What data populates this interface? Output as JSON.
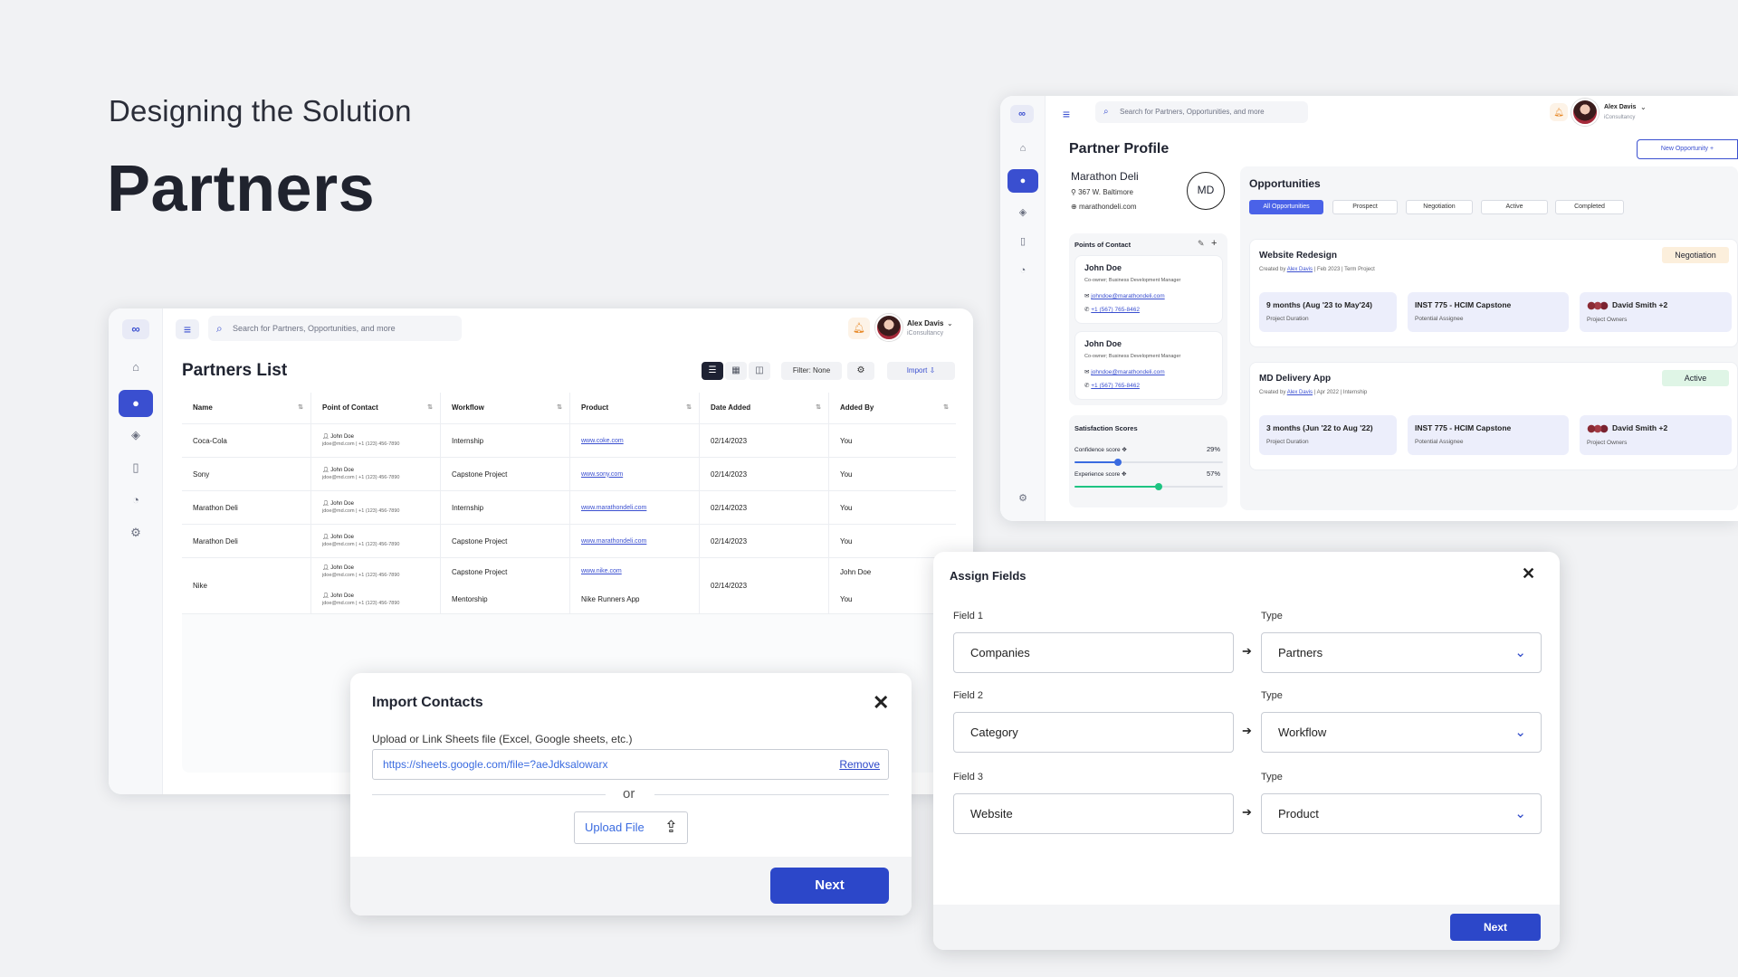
{
  "header": {
    "subtitle": "Designing the Solution",
    "title": "Partners"
  },
  "app": {
    "logo": "∞",
    "search_placeholder": "Search for Partners, Opportunities, and more",
    "user_name": "Alex Davis",
    "user_org": "iConsultancy"
  },
  "partners_list": {
    "title": "Partners List",
    "filter_label": "Filter: None",
    "import_label": "Import",
    "columns": [
      "Name",
      "Point of Contact",
      "Workflow",
      "Product",
      "Date Added",
      "Added By"
    ],
    "rows": [
      {
        "name": "Coca-Cola",
        "contact": "John Doe",
        "contact_detail": "jdoe@md.com | +1 (123) 456-7890",
        "workflow": "Internship",
        "product": "www.coke.com",
        "date": "02/14/2023",
        "added_by": "You"
      },
      {
        "name": "Sony",
        "contact": "John Doe",
        "contact_detail": "jdoe@md.com | +1 (123) 456-7890",
        "workflow": "Capstone Project",
        "product": "www.sony.com",
        "date": "02/14/2023",
        "added_by": "You"
      },
      {
        "name": "Marathon Deli",
        "contact": "John Doe",
        "contact_detail": "jdoe@md.com | +1 (123) 456-7890",
        "workflow": "Internship",
        "product": "www.marathondeli.com",
        "date": "02/14/2023",
        "added_by": "You"
      },
      {
        "name": "Marathon Deli",
        "contact": "John Doe",
        "contact_detail": "jdoe@md.com | +1 (123) 456-7890",
        "workflow": "Capstone Project",
        "product": "www.marathondeli.com",
        "date": "02/14/2023",
        "added_by": "You"
      }
    ],
    "nike": {
      "name": "Nike",
      "contact": "John Doe",
      "contact_detail": "jdoe@md.com | +1 (123) 456-7890",
      "workflow_1": "Capstone Project",
      "workflow_2": "Mentorship",
      "product_1": "www.nike.com",
      "product_2": "Nike Runners App",
      "date": "02/14/2023",
      "added_by_1": "John Doe",
      "added_by_2": "You"
    }
  },
  "partner_profile": {
    "title": "Partner Profile",
    "new_opportunity": "New Opportunity +",
    "partner_name": "Marathon Deli",
    "address": "367 W. Baltimore",
    "website": "marathondeli.com",
    "initials": "MD",
    "contacts_title": "Points of Contact",
    "contacts": [
      {
        "name": "John Doe",
        "role": "Co-owner; Business Development Manager",
        "email": "johndoe@marathondeli.com",
        "phone": "+1 (567) 765-8462"
      },
      {
        "name": "John Doe",
        "role": "Co-owner; Business Development Manager",
        "email": "johndoe@marathondeli.com",
        "phone": "+1 (567) 765-8462"
      }
    ],
    "satisfaction_title": "Satisfaction Scores",
    "confidence_label": "Confidence score",
    "confidence_value": "29%",
    "confidence_level": 0.29,
    "experience_label": "Experience score",
    "experience_value": "57%",
    "experience_level": 0.57,
    "opportunities_title": "Opportunities",
    "filters": [
      "All Opportunities",
      "Prospect",
      "Negotiation",
      "Active",
      "Completed"
    ],
    "opportunities": [
      {
        "title": "Website Redesign",
        "status": "Negotiation",
        "created_prefix": "Created by",
        "created_by": "Alex Davis",
        "created_suffix": "| Feb 2023 | Term Project",
        "duration": "9 months (Aug '23 to May'24)",
        "duration_label": "Project Duration",
        "assignee": "INST 775 - HCIM Capstone",
        "assignee_label": "Potential Assignee",
        "owners": "David Smith +2",
        "owners_label": "Project Owners"
      },
      {
        "title": "MD Delivery App",
        "status": "Active",
        "created_prefix": "Created by",
        "created_by": "Alex Davis",
        "created_suffix": "| Apr 2022 | Internship",
        "duration": "3 months (Jun '22 to Aug '22)",
        "duration_label": "Project Duration",
        "assignee": "INST 775 - HCIM Capstone",
        "assignee_label": "Potential Assignee",
        "owners": "David Smith +2",
        "owners_label": "Project Owners"
      }
    ]
  },
  "import_modal": {
    "title": "Import Contacts",
    "upload_label": "Upload or Link Sheets file (Excel, Google sheets, etc.)",
    "url_value": "https://sheets.google.com/file=?aeJdksalowarx",
    "remove_label": "Remove",
    "or_label": "or",
    "upload_button": "Upload File",
    "next_button": "Next"
  },
  "assign_modal": {
    "title": "Assign Fields",
    "fields": [
      {
        "label": "Field 1",
        "value": "Companies",
        "type_label": "Type",
        "type_value": "Partners"
      },
      {
        "label": "Field 2",
        "value": "Category",
        "type_label": "Type",
        "type_value": "Workflow"
      },
      {
        "label": "Field 3",
        "value": "Website",
        "type_label": "Type",
        "type_value": "Product"
      }
    ],
    "next_button": "Next"
  },
  "colors": {
    "accent": "#2c47c9",
    "negotiation_bg": "#fcefdc",
    "active_bg": "#dff5e6",
    "slider_blue": "#3a6be0",
    "slider_green": "#1ec482"
  }
}
